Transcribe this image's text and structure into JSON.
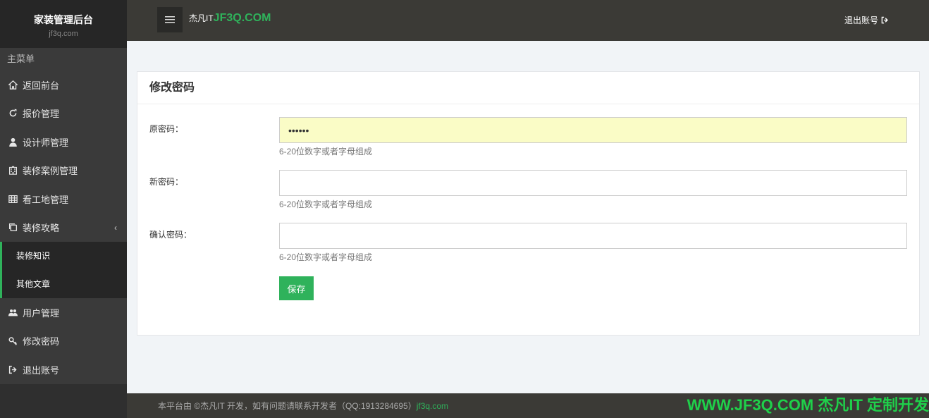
{
  "brand": {
    "title": "家装管理后台",
    "subtitle": "jf3q.com"
  },
  "sidebar": {
    "header": "主菜单",
    "items": [
      {
        "label": "返回前台",
        "icon": "home-icon"
      },
      {
        "label": "报价管理",
        "icon": "refresh-icon"
      },
      {
        "label": "设计师管理",
        "icon": "user-icon"
      },
      {
        "label": "装修案例管理",
        "icon": "building-icon"
      },
      {
        "label": "看工地管理",
        "icon": "grid-icon"
      },
      {
        "label": "装修攻略",
        "icon": "copy-icon",
        "chevron": "‹"
      }
    ],
    "submenu": [
      {
        "label": "装修知识"
      },
      {
        "label": "其他文章"
      }
    ],
    "bottom_items": [
      {
        "label": "用户管理",
        "icon": "users-icon"
      },
      {
        "label": "修改密码",
        "icon": "key-icon"
      },
      {
        "label": "退出账号",
        "icon": "sign-out-icon"
      }
    ]
  },
  "topbar": {
    "brand_prefix": "杰凡IT",
    "brand_highlight": "JF3Q.COM",
    "logout": "退出账号"
  },
  "form": {
    "title": "修改密码",
    "fields": [
      {
        "label": "原密码：",
        "value": "••••••",
        "hint": "6-20位数字或者字母组成"
      },
      {
        "label": "新密码：",
        "value": "",
        "hint": "6-20位数字或者字母组成"
      },
      {
        "label": "确认密码：",
        "value": "",
        "hint": "6-20位数字或者字母组成"
      }
    ],
    "save_label": "保存"
  },
  "footer": {
    "text": "本平台由 ©杰凡IT 开发，如有问题请联系开发者（QQ:1913284695）",
    "link": "jf3q.com",
    "watermark": "WWW.JF3Q.COM 杰凡IT  定制开发"
  },
  "colors": {
    "accent": "#2fb25b",
    "sidebar": "#3a3a3a",
    "topbar": "#3b3a36"
  }
}
